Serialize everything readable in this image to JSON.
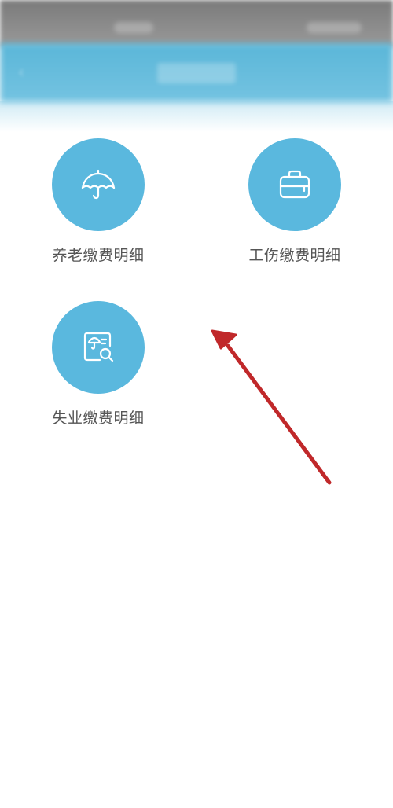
{
  "status_bar": {},
  "header": {
    "back_icon": "back-arrow-icon"
  },
  "tiles": [
    {
      "label": "养老缴费明细",
      "icon": "umbrella-icon"
    },
    {
      "label": "工伤缴费明细",
      "icon": "briefcase-icon"
    },
    {
      "label": "失业缴费明细",
      "icon": "document-search-icon"
    }
  ],
  "colors": {
    "primary": "#5ab8de",
    "header": "#5ab6d8",
    "label": "#555555",
    "annotation_arrow": "#c0282a"
  }
}
